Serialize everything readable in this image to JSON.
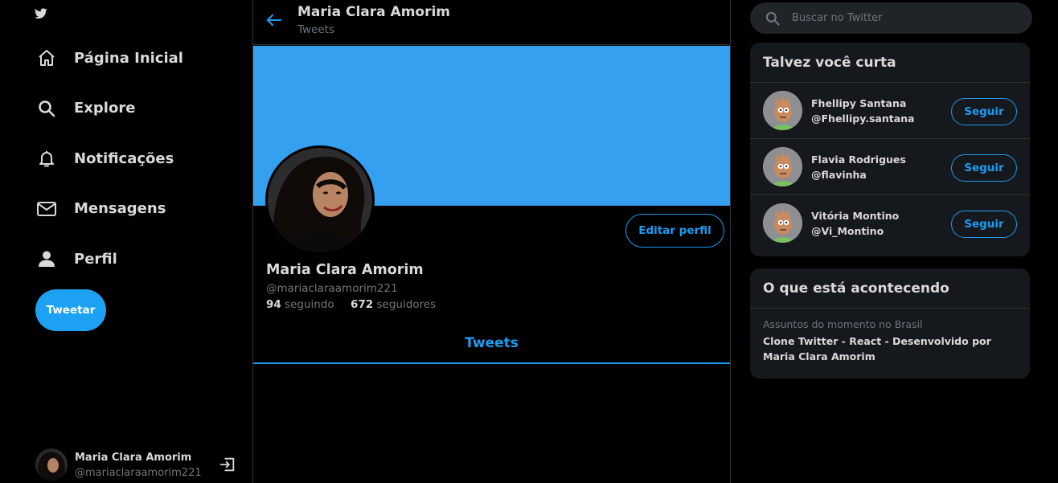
{
  "colors": {
    "background": "#000000",
    "accent": "#1d9bf0",
    "banner": "#359ff0",
    "panel": "#15181c",
    "border": "#2f3336",
    "muted": "#6e767d"
  },
  "sidebar": {
    "logo_icon": "twitter-bird-icon",
    "nav": [
      {
        "label": "Página Inicial",
        "icon": "home-icon"
      },
      {
        "label": "Explore",
        "icon": "search-icon"
      },
      {
        "label": "Notificações",
        "icon": "bell-icon"
      },
      {
        "label": "Mensagens",
        "icon": "mail-icon"
      },
      {
        "label": "Perfil",
        "icon": "person-icon"
      }
    ],
    "tweet_button": "Tweetar",
    "account": {
      "name": "Maria Clara Amorim",
      "handle": "@mariaclaraamorim221",
      "logout_icon": "logout-icon"
    }
  },
  "main": {
    "header": {
      "title": "Maria Clara Amorim",
      "subtitle": "Tweets",
      "back_icon": "arrow-left-icon"
    },
    "profile": {
      "name": "Maria Clara Amorim",
      "handle": "@mariaclaraamorim221",
      "following_count": "94",
      "following_label": "seguindo",
      "followers_count": "672",
      "followers_label": "seguidores",
      "edit_button": "Editar perfil"
    },
    "tabs": [
      {
        "label": "Tweets",
        "active": true
      }
    ]
  },
  "right": {
    "search": {
      "placeholder": "Buscar no Twitter",
      "value": ""
    },
    "who_to_follow": {
      "title": "Talvez você curta",
      "follow_label": "Seguir",
      "users": [
        {
          "name": "Fhellipy Santana",
          "handle": "@Fhellipy.santana"
        },
        {
          "name": "Flavia Rodrigues",
          "handle": "@flavinha"
        },
        {
          "name": "Vitória Montino",
          "handle": "@Vi_Montino"
        }
      ]
    },
    "trends": {
      "title": "O que está acontecendo",
      "items": [
        {
          "category": "Assuntos do momento no Brasil",
          "topic": "Clone Twitter - React - Desenvolvido por Maria Clara Amorim"
        }
      ]
    }
  }
}
